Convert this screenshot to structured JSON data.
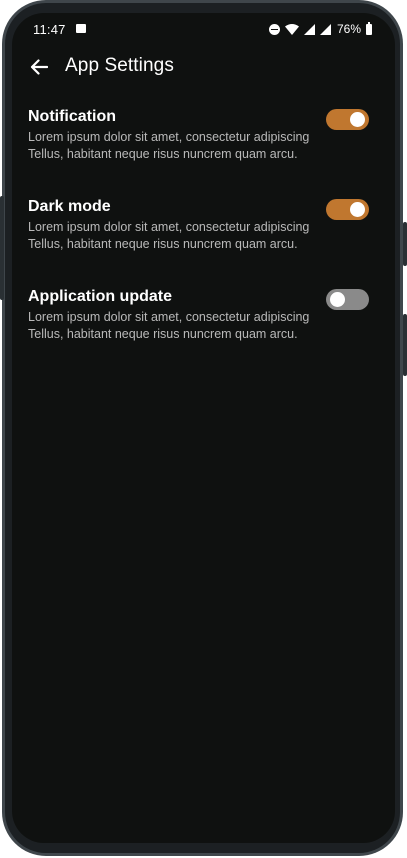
{
  "status_bar": {
    "time": "11:47",
    "battery": "76%"
  },
  "header": {
    "title": "App Settings"
  },
  "settings": [
    {
      "title": "Notification",
      "description": "Lorem ipsum dolor sit amet, consectetur adipiscing Tellus, habitant neque risus nuncrem quam arcu.",
      "enabled": true
    },
    {
      "title": "Dark mode",
      "description": "Lorem ipsum dolor sit amet, consectetur adipiscing Tellus, habitant neque risus nuncrem quam arcu.",
      "enabled": true
    },
    {
      "title": "Application update",
      "description": "Lorem ipsum dolor sit amet, consectetur adipiscing Tellus, habitant neque risus nuncrem quam arcu.",
      "enabled": false
    }
  ],
  "icons": {
    "back": "arrow-left-icon",
    "gallery": "image-icon",
    "dnd": "do-not-disturb-icon",
    "wifi": "wifi-icon",
    "signal": "cellular-signal-icon",
    "battery": "battery-icon"
  },
  "colors": {
    "accent": "#c0772f",
    "background": "#0f1110",
    "toggle_off": "#8a8a8a",
    "description_text": "#b9b9b9"
  }
}
